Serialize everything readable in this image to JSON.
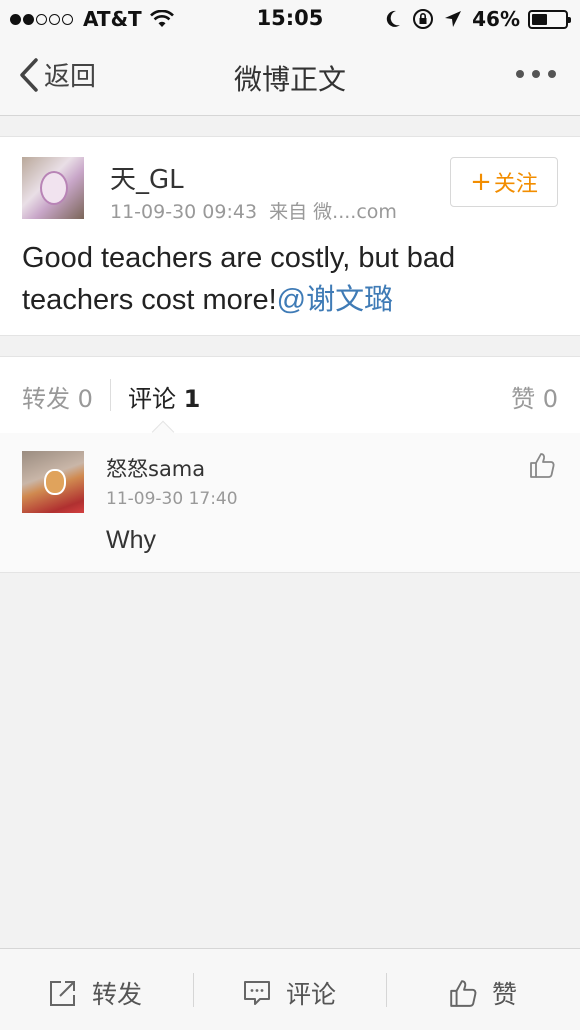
{
  "status_bar": {
    "carrier": "AT&T",
    "time": "15:05",
    "battery": "46%",
    "battery_level": 0.46,
    "icons": [
      "signal-dots-icon",
      "wifi-icon",
      "moon-icon",
      "rotation-lock-icon",
      "location-arrow-icon",
      "battery-icon"
    ]
  },
  "nav": {
    "back_label": "返回",
    "title": "微博正文",
    "more_icon": "more-dots-icon"
  },
  "post": {
    "username": "天_GL",
    "timestamp": "11-09-30 09:43",
    "source": "来自 微....com",
    "follow_label": "关注",
    "follow_plus": "+",
    "text": "Good teachers are costly, but bad teachers cost more!",
    "mention": "@谢文璐"
  },
  "stats": {
    "repost_label": "转发",
    "repost_count": "0",
    "comment_label": "评论",
    "comment_count": "1",
    "like_label": "赞",
    "like_count": "0"
  },
  "comments": [
    {
      "username": "怒怒sama",
      "timestamp": "11-09-30 17:40",
      "text": "Why"
    }
  ],
  "toolbar": {
    "repost_label": "转发",
    "comment_label": "评论",
    "like_label": "赞"
  },
  "colors": {
    "accent_orange": "#f28d00",
    "mention_blue": "#3f7bb6",
    "background": "#f2f2f2"
  }
}
